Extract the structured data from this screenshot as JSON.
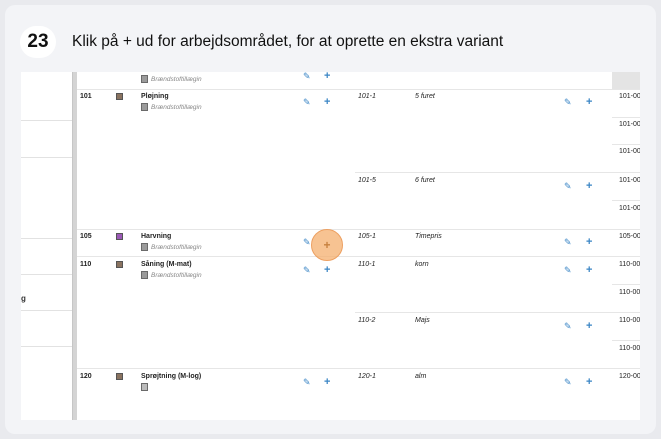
{
  "step": {
    "number": "23",
    "text": "Klik på + ud for arbejdsområdet, for at oprette en ekstra variant"
  },
  "left_panel": {
    "partial_label": "g"
  },
  "icons": {
    "edit": "pencil-icon",
    "add": "plus-icon",
    "doc": "document-icon"
  },
  "colors": {
    "accent": "#3a85c5",
    "highlight": "#f4af6e",
    "purple_swatch": "#9b59b6",
    "brown_swatch": "#8a7360"
  },
  "rows": [
    {
      "code": "",
      "name": "",
      "sub": "Brændstoftillægin",
      "color": "",
      "variants": []
    },
    {
      "code": "101",
      "name": "Pløjning",
      "sub": "Brændstoftillægin",
      "color": "#8a7360",
      "variants": [
        {
          "code": "101-1",
          "desc": "5 furet",
          "refs": [
            "101-00",
            "101-00",
            "101-00"
          ]
        },
        {
          "code": "101-5",
          "desc": "6 furet",
          "refs": [
            "101-00",
            "101-00"
          ]
        }
      ]
    },
    {
      "code": "105",
      "name": "Harvning",
      "sub": "Brændstoftillægin",
      "color": "#9b59b6",
      "variants": [
        {
          "code": "105-1",
          "desc": "Timepris",
          "refs": [
            "105-00"
          ]
        }
      ]
    },
    {
      "code": "110",
      "name": "Såning (M-mat)",
      "sub": "Brændstoftillægin",
      "color": "#8a7360",
      "variants": [
        {
          "code": "110-1",
          "desc": "korn",
          "refs": [
            "110-00",
            "110-00"
          ]
        },
        {
          "code": "110-2",
          "desc": "Majs",
          "refs": [
            "110-00",
            "110-00"
          ]
        }
      ]
    },
    {
      "code": "120",
      "name": "Sprøjtning (M-log)",
      "sub": "",
      "color": "#8a7360",
      "variants": [
        {
          "code": "120-1",
          "desc": "alm",
          "refs": [
            "120-00"
          ]
        }
      ]
    }
  ]
}
